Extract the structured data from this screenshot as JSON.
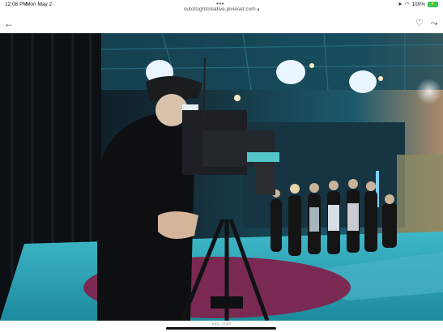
{
  "status_bar": {
    "time": "12:08 PM",
    "date": "Mon May 2",
    "multitask_dots": "•••",
    "location_icon": "location-arrow-icon",
    "wifi_icon": "wifi-icon",
    "battery_percent": "100%",
    "battery_glyph": "⚡"
  },
  "browser": {
    "url": "outofsightcreative.pixieset.com",
    "lock_icon": "lock-icon"
  },
  "nav": {
    "back_icon": "arrow-left-icon",
    "favorite_icon": "heart-icon",
    "share_icon": "share-icon"
  },
  "photo": {
    "subject": "film studio scene with camera operator and line of performers",
    "caption": "IMG_0086"
  },
  "colors": {
    "studio_teal": "#2fb7c6",
    "floor_magenta": "#7a2a52",
    "drape_dark": "#0b1015",
    "battery_green": "#34c759"
  }
}
